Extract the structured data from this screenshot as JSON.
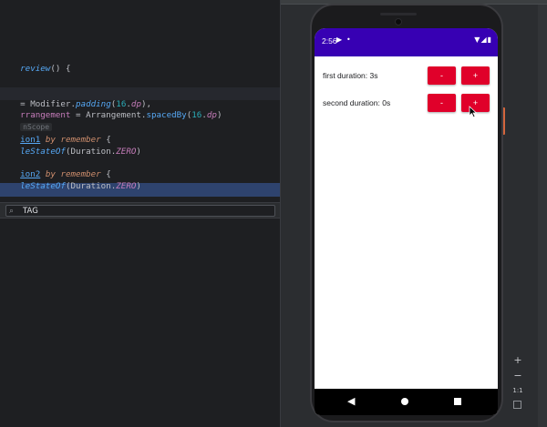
{
  "editor": {
    "lines": [
      {
        "t": "top"
      },
      {
        "parts": [
          [
            "fn",
            "review"
          ],
          [
            "",
            "() {"
          ]
        ]
      },
      {
        "parts": [
          [
            "",
            "= Modifier."
          ],
          [
            "fnit",
            "padding"
          ],
          [
            "",
            "("
          ],
          [
            "num",
            "16"
          ],
          [
            "",
            "."
          ],
          [
            "unit",
            "dp"
          ],
          [
            "",
            "),"
          ]
        ]
      },
      {
        "parts": [
          [
            "prop",
            "rrangement"
          ],
          [
            "",
            " = Arrangement."
          ],
          [
            "fn",
            "spacedBy"
          ],
          [
            "",
            "("
          ],
          [
            "num",
            "16"
          ],
          [
            "",
            "."
          ],
          [
            "unit",
            "dp"
          ],
          [
            "",
            ")"
          ]
        ]
      },
      {
        "parts": [
          [
            "hint",
            "nScope"
          ]
        ]
      },
      {
        "parts": [
          [
            "fnu",
            "ion1"
          ],
          [
            "",
            " "
          ],
          [
            "kw",
            "by"
          ],
          [
            "",
            " "
          ],
          [
            "kw",
            "remember"
          ],
          [
            "",
            " {"
          ]
        ]
      },
      {
        "parts": [
          [
            "fnit",
            "leStateOf"
          ],
          [
            "",
            "(Duration."
          ],
          [
            "static",
            "ZERO"
          ],
          [
            "",
            ")"
          ]
        ]
      },
      {
        "parts": [
          [
            "fnu",
            "ion2"
          ],
          [
            "",
            " "
          ],
          [
            "kw",
            "by"
          ],
          [
            "",
            " "
          ],
          [
            "kw",
            "remember"
          ],
          [
            "",
            " {"
          ]
        ]
      },
      {
        "parts": [
          [
            "fnit",
            "leStateOf"
          ],
          [
            "",
            "(Duration."
          ],
          [
            "static",
            "ZERO"
          ],
          [
            "",
            ")"
          ]
        ]
      }
    ],
    "find_value": "TAG"
  },
  "emulator": {
    "status_time": "2:56",
    "rows": [
      {
        "label": "first duration: 3s",
        "minus": "-",
        "plus": "+"
      },
      {
        "label": "second duration: 0s",
        "minus": "-",
        "plus": "+"
      }
    ],
    "zoom_in": "+",
    "zoom_out": "−",
    "zoom_reset": "1:1"
  },
  "colors": {
    "status_bar": "#3700b3",
    "button": "#e0002a",
    "editor_bg": "#1e1f22"
  }
}
